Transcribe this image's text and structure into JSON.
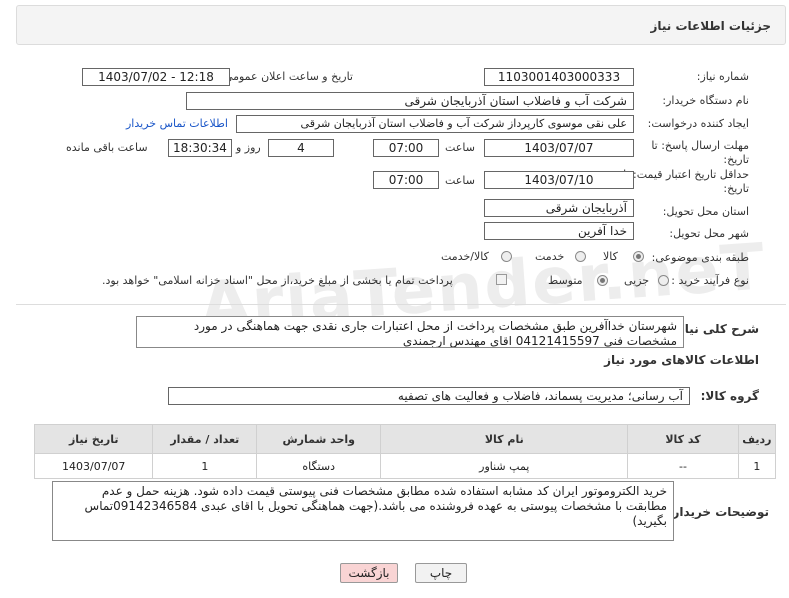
{
  "header": {
    "title": "جزئیات اطلاعات نیاز"
  },
  "watermark": "AriaTender.neT",
  "form": {
    "need_number": {
      "label": "شماره نیاز:",
      "value": "1103001403000333"
    },
    "announce": {
      "label": "تاریخ و ساعت اعلان عمومی:",
      "value": "1403/07/02 - 12:18"
    },
    "buyer": {
      "label": "نام دستگاه خریدار:",
      "value": "شرکت آب و فاضلاب استان آذربایجان شرقی"
    },
    "requester": {
      "label": "ایجاد کننده درخواست:",
      "value": "علی نقی موسوی کارپرداز شرکت آب و فاضلاب استان آذربایجان شرقی",
      "contact_link": "اطلاعات تماس خریدار"
    },
    "reply_deadline": {
      "label_line1": "مهلت ارسال پاسخ: تا",
      "label_line2": "تاریخ:",
      "date": "1403/07/07",
      "time_label": "ساعت",
      "time": "07:00",
      "days": "4",
      "days_label": "روز و",
      "remaining": "18:30:34",
      "remaining_label": "ساعت باقی مانده"
    },
    "price_validity": {
      "label_line1": "حداقل تاریخ اعتبار قیمت: تا",
      "label_line2": "تاریخ:",
      "date": "1403/07/10",
      "time_label": "ساعت",
      "time": "07:00"
    },
    "province": {
      "label": "استان محل تحویل:",
      "value": "آذربایجان شرقی"
    },
    "city": {
      "label": "شهر محل تحویل:",
      "value": "خدا آفرین"
    },
    "category": {
      "label": "طبقه بندی موضوعی:",
      "options": [
        "کالا",
        "خدمت",
        "کالا/خدمت"
      ],
      "selected": "کالا"
    },
    "purchase_type": {
      "label": "نوع فرآیند خرید :",
      "options": [
        "جزیی",
        "متوسط"
      ],
      "selected": "متوسط",
      "note": "پرداخت تمام یا بخشی از مبلغ خرید،از محل \"اسناد خزانه اسلامی\" خواهد بود."
    }
  },
  "description": {
    "label": "شرح کلی نیاز:",
    "text": "شهرستان خداآفرین   طبق مشخصات پرداخت از محل اعتبارات جاری نقدی جهت هماهنگی در مورد مشخصات فنی 04121415597 اقای مهندس ارجمندی"
  },
  "goods_section": {
    "title": "اطلاعات کالاهای مورد نیاز"
  },
  "goods_group": {
    "label": "گروه کالا:",
    "value": "آب رسانی؛ مدیریت پسماند، فاضلاب و فعالیت های تصفیه"
  },
  "table": {
    "headers": [
      "ردیف",
      "کد کالا",
      "نام کالا",
      "واحد شمارش",
      "تعداد / مقدار",
      "تاریخ نیاز"
    ],
    "rows": [
      [
        "1",
        "--",
        "پمپ شناور",
        "دستگاه",
        "1",
        "1403/07/07"
      ]
    ]
  },
  "buyer_notes": {
    "label": "توضیحات خریدار:",
    "text": "خرید   الکتروموتور   ایران کد مشابه استفاده شده مطابق مشخصات فنی پیوستی قیمت داده شود. هزینه حمل و عدم مطابقت با مشخصات پیوستی به عهده فروشنده می باشد.(جهت هماهنگی تحویل با اقای عبدی 09142346584تماس بگیرید)"
  },
  "buttons": {
    "print": "چاپ",
    "back": "بازگشت"
  },
  "colors": {
    "back_button_bg": "#f9d4d4",
    "print_button_bg": "#f2f2f2",
    "link": "#1a56c8"
  }
}
